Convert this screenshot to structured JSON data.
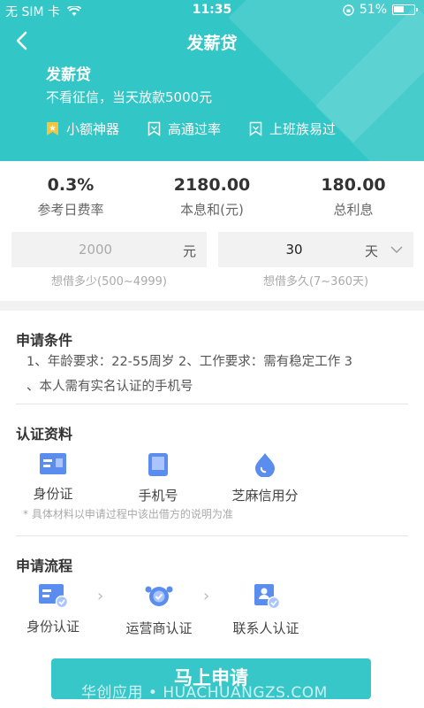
{
  "status_bar": {
    "carrier": "无 SIM 卡",
    "time": "11:35",
    "battery_text": "51%",
    "battery_level": 0.51
  },
  "nav": {
    "title": "发薪贷",
    "back_icon": "chevron-left-icon"
  },
  "product": {
    "name": "发薪贷",
    "description": "不看征信，当天放款5000元",
    "tags": [
      {
        "label": "小额神器",
        "icon": "star-bookmark-icon",
        "color": "#f5c542"
      },
      {
        "label": "高通过率",
        "icon": "bookmark-icon",
        "color": "#ffffff"
      },
      {
        "label": "上班族易过",
        "icon": "bookmark-icon",
        "color": "#ffffff"
      }
    ]
  },
  "calculator": {
    "stats": [
      {
        "value": "0.3%",
        "label": "参考日费率"
      },
      {
        "value": "2180.00",
        "label": "本息和(元)"
      },
      {
        "value": "180.00",
        "label": "总利息"
      }
    ],
    "amount": {
      "placeholder": "2000",
      "unit": "元",
      "hint": "想借多少(500~4999)"
    },
    "term": {
      "value": "30",
      "unit": "天",
      "hint": "想借多久(7~360天)"
    }
  },
  "conditions": {
    "title": "申请条件",
    "line1": "1、年龄要求：22-55周岁 2、工作要求：需有稳定工作 3",
    "line2": "、本人需有实名认证的手机号"
  },
  "certification": {
    "title": "认证资料",
    "items": [
      {
        "label": "身份证",
        "icon": "id-card-icon"
      },
      {
        "label": "手机号",
        "icon": "phone-icon"
      },
      {
        "label": "芝麻信用分",
        "icon": "sesame-credit-icon"
      }
    ],
    "note": "* 具体材料以申请过程中该出借方的说明为准"
  },
  "process": {
    "title": "申请流程",
    "steps": [
      {
        "label": "身份认证",
        "icon": "id-verified-icon"
      },
      {
        "label": "运营商认证",
        "icon": "carrier-verified-icon"
      },
      {
        "label": "联系人认证",
        "icon": "contacts-verified-icon"
      }
    ]
  },
  "apply_button": "马上申请",
  "watermark": "华创应用 • HUACHUANGZS.COM",
  "colors": {
    "primary": "#33c6c6",
    "button": "#38c7c9",
    "icon_blue": "#5b8def"
  }
}
